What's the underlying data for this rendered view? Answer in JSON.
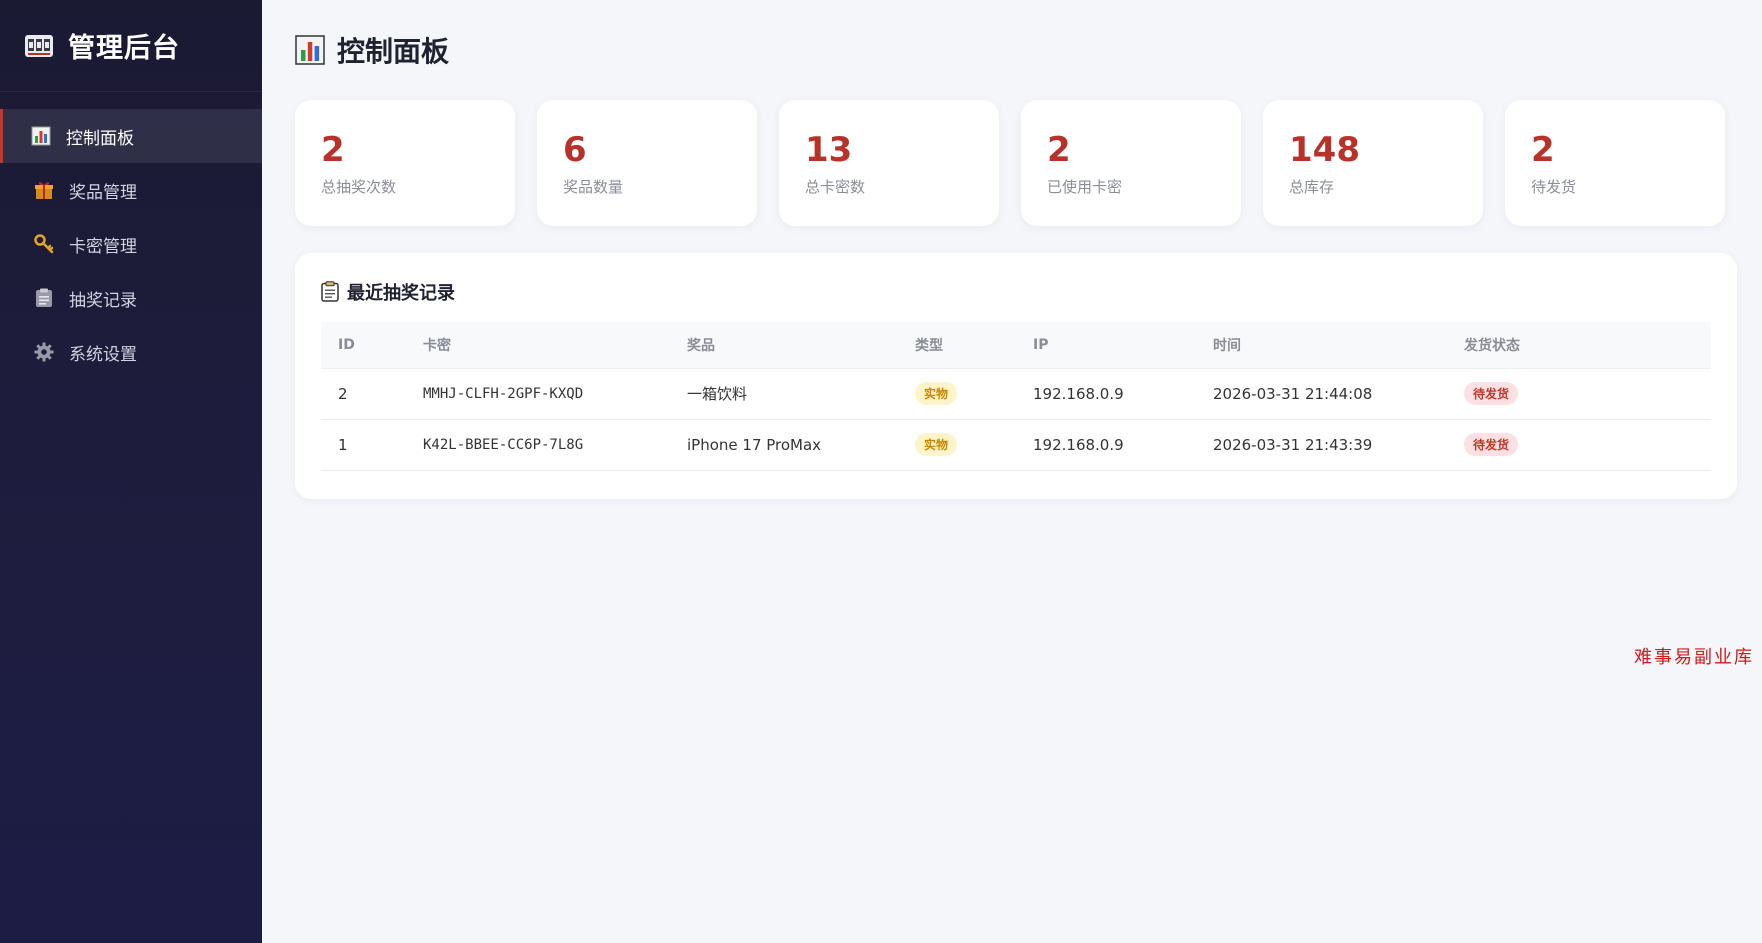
{
  "sidebar": {
    "brand_title": "管理后台",
    "brand_icon": "slot-machine-icon",
    "items": [
      {
        "label": "控制面板",
        "icon": "bar-chart-icon",
        "active": true
      },
      {
        "label": "奖品管理",
        "icon": "gift-icon",
        "active": false
      },
      {
        "label": "卡密管理",
        "icon": "key-icon",
        "active": false
      },
      {
        "label": "抽奖记录",
        "icon": "clipboard-icon",
        "active": false
      },
      {
        "label": "系统设置",
        "icon": "gear-icon",
        "active": false
      }
    ]
  },
  "header": {
    "title": "控制面板",
    "icon": "bar-chart-icon"
  },
  "stats": [
    {
      "value": "2",
      "label": "总抽奖次数"
    },
    {
      "value": "6",
      "label": "奖品数量"
    },
    {
      "value": "13",
      "label": "总卡密数"
    },
    {
      "value": "2",
      "label": "已使用卡密"
    },
    {
      "value": "148",
      "label": "总库存"
    },
    {
      "value": "2",
      "label": "待发货"
    }
  ],
  "records": {
    "title": "最近抽奖记录",
    "icon": "clipboard-icon",
    "columns": [
      "ID",
      "卡密",
      "奖品",
      "类型",
      "IP",
      "时间",
      "发货状态"
    ],
    "rows": [
      {
        "id": "2",
        "card": "MMHJ-CLFH-2GPF-KXQD",
        "prize": "一箱饮料",
        "type": "实物",
        "ip": "192.168.0.9",
        "time": "2026-03-31 21:44:08",
        "status": "待发货"
      },
      {
        "id": "1",
        "card": "K42L-BBEE-CC6P-7L8G",
        "prize": "iPhone 17 ProMax",
        "type": "实物",
        "ip": "192.168.0.9",
        "time": "2026-03-31 21:43:39",
        "status": "待发货"
      }
    ]
  },
  "watermark": "难事易副业库",
  "colors": {
    "accent": "#b8322a",
    "sidebar_bg": "#1e1d3f",
    "type_badge_bg": "#fff3c9",
    "status_badge_bg": "#fde0e3"
  }
}
